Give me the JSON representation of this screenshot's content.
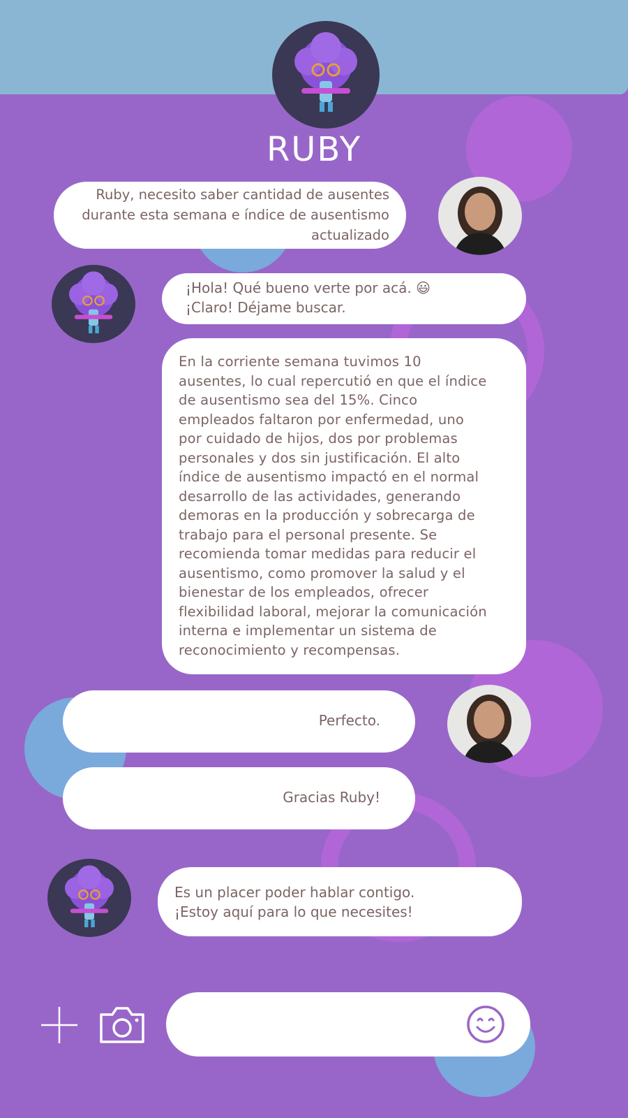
{
  "assistant": {
    "name": "RUBY"
  },
  "messages": [
    {
      "sender": "user",
      "lines": [
        "Ruby, necesito saber cantidad de ausentes",
        "durante esta semana e índice de ausentismo",
        "actualizado"
      ]
    },
    {
      "sender": "bot",
      "lines": [
        "¡Hola! Qué bueno verte por acá. 😃",
        "¡Claro! Déjame buscar."
      ]
    },
    {
      "sender": "bot",
      "lines": [
        "En la corriente semana tuvimos 10",
        "ausentes, lo cual repercutió en que el índice",
        "de ausentismo sea del 15%. Cinco",
        "empleados faltaron por enfermedad, uno",
        "por cuidado de hijos, dos por problemas",
        "personales y dos sin justificación. El alto",
        "índice de ausentismo impactó en el normal",
        "desarrollo de las actividades, generando",
        "demoras en la producción y sobrecarga de",
        "trabajo para el personal presente. Se",
        "recomienda tomar medidas para reducir el",
        "ausentismo, como promover la salud y el",
        "bienestar de los empleados, ofrecer",
        "flexibilidad laboral, mejorar la comunicación",
        "interna e implementar un sistema de",
        "reconocimiento y recompensas."
      ]
    },
    {
      "sender": "user",
      "lines": [
        "Perfecto."
      ]
    },
    {
      "sender": "user",
      "lines": [
        "Gracias Ruby!"
      ]
    },
    {
      "sender": "bot",
      "lines": [
        "Es un placer poder hablar contigo.",
        "¡Estoy aquí para lo que necesites!"
      ]
    }
  ],
  "composer": {
    "value": ""
  },
  "icons": {
    "add": "plus-icon",
    "camera": "camera-icon",
    "emoji": "smiley-icon"
  },
  "colors": {
    "background": "#9866c8",
    "header": "#8ab6d4",
    "bubble": "#ffffff",
    "text": "#7b6464",
    "accent_purple": "#b166d8",
    "accent_blue": "#7aa9dc"
  }
}
